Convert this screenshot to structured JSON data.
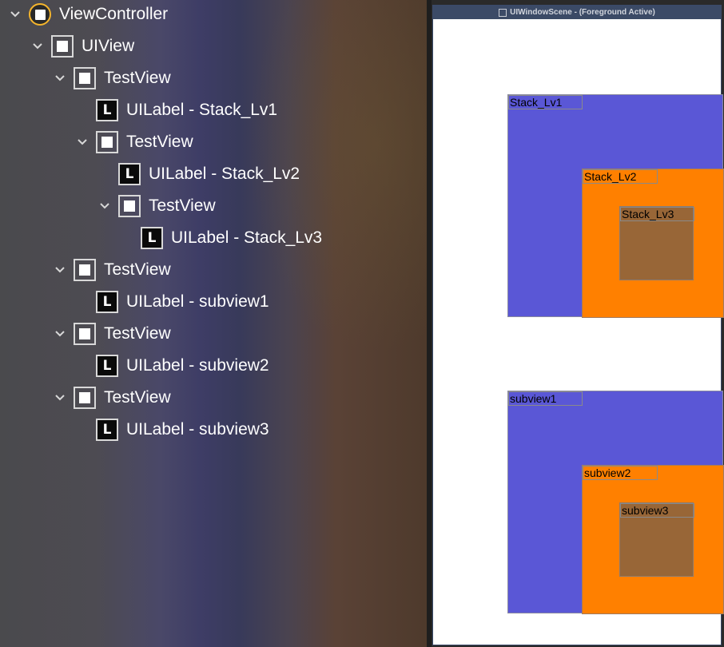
{
  "hierarchy": [
    {
      "id": "vc",
      "label": "ViewController",
      "icon": "view-controller-icon",
      "expanded": true
    },
    {
      "id": "uiview",
      "label": "UIView",
      "icon": "view-icon",
      "expanded": true
    },
    {
      "id": "tv1",
      "label": "TestView",
      "icon": "view-icon",
      "expanded": true
    },
    {
      "id": "l1",
      "label": "UILabel - Stack_Lv1",
      "icon": "label-icon",
      "icon_glyph": "L"
    },
    {
      "id": "tv2",
      "label": "TestView",
      "icon": "view-icon",
      "expanded": true
    },
    {
      "id": "l2",
      "label": "UILabel - Stack_Lv2",
      "icon": "label-icon",
      "icon_glyph": "L"
    },
    {
      "id": "tv3",
      "label": "TestView",
      "icon": "view-icon",
      "expanded": true
    },
    {
      "id": "l3",
      "label": "UILabel - Stack_Lv3",
      "icon": "label-icon",
      "icon_glyph": "L"
    },
    {
      "id": "tv4",
      "label": "TestView",
      "icon": "view-icon",
      "expanded": true
    },
    {
      "id": "l4",
      "label": "UILabel - subview1",
      "icon": "label-icon",
      "icon_glyph": "L"
    },
    {
      "id": "tv5",
      "label": "TestView",
      "icon": "view-icon",
      "expanded": true
    },
    {
      "id": "l5",
      "label": "UILabel - subview2",
      "icon": "label-icon",
      "icon_glyph": "L"
    },
    {
      "id": "tv6",
      "label": "TestView",
      "icon": "view-icon",
      "expanded": true
    },
    {
      "id": "l6",
      "label": "UILabel - subview3",
      "icon": "label-icon",
      "icon_glyph": "L"
    }
  ],
  "scene": {
    "title": "UIWindowScene - (Foreground Active)",
    "stack_labels": [
      "Stack_Lv1",
      "Stack_Lv2",
      "Stack_Lv3"
    ],
    "subview_labels": [
      "subview1",
      "subview2",
      "subview3"
    ]
  },
  "colors": {
    "level1": "#5a57d6",
    "level2": "#ff8000",
    "level3": "#986637",
    "view_controller_ring": "#f5b52c"
  }
}
